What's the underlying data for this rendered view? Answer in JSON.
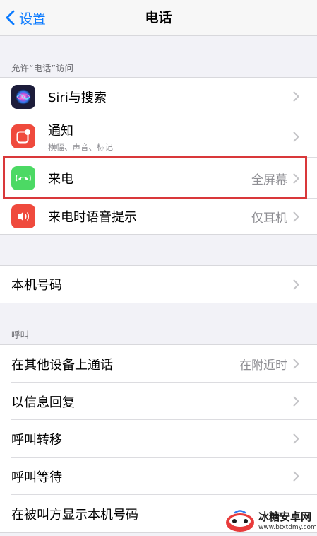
{
  "nav": {
    "back_label": "设置",
    "title": "电话"
  },
  "sections": {
    "access_header": "允许“电话”访问",
    "calls_header": "呼叫"
  },
  "access_items": [
    {
      "label": "Siri与搜索",
      "subtitle": "",
      "value": "",
      "icon": "siri-icon",
      "icon_color": "#1c1c3a"
    },
    {
      "label": "通知",
      "subtitle": "横幅、声音、标记",
      "value": "",
      "icon": "notifications-icon",
      "icon_color": "#ef4a3d"
    },
    {
      "label": "来电",
      "subtitle": "",
      "value": "全屏幕",
      "icon": "incoming-call-icon",
      "icon_color": "#4cd964"
    },
    {
      "label": "来电时语音提示",
      "subtitle": "",
      "value": "仅耳机",
      "icon": "announce-calls-icon",
      "icon_color": "#ef4a3d"
    }
  ],
  "my_number": {
    "label": "本机号码"
  },
  "call_items": [
    {
      "label": "在其他设备上通话",
      "value": "在附近时"
    },
    {
      "label": "以信息回复",
      "value": ""
    },
    {
      "label": "呼叫转移",
      "value": ""
    },
    {
      "label": "呼叫等待",
      "value": ""
    },
    {
      "label": "在被叫方显示本机号码",
      "value": ""
    }
  ],
  "watermark": {
    "name": "冰糖安卓网",
    "url": "www.btxtdmy.com"
  },
  "colors": {
    "accent": "#0a7aff",
    "highlight": "#d9383a"
  }
}
